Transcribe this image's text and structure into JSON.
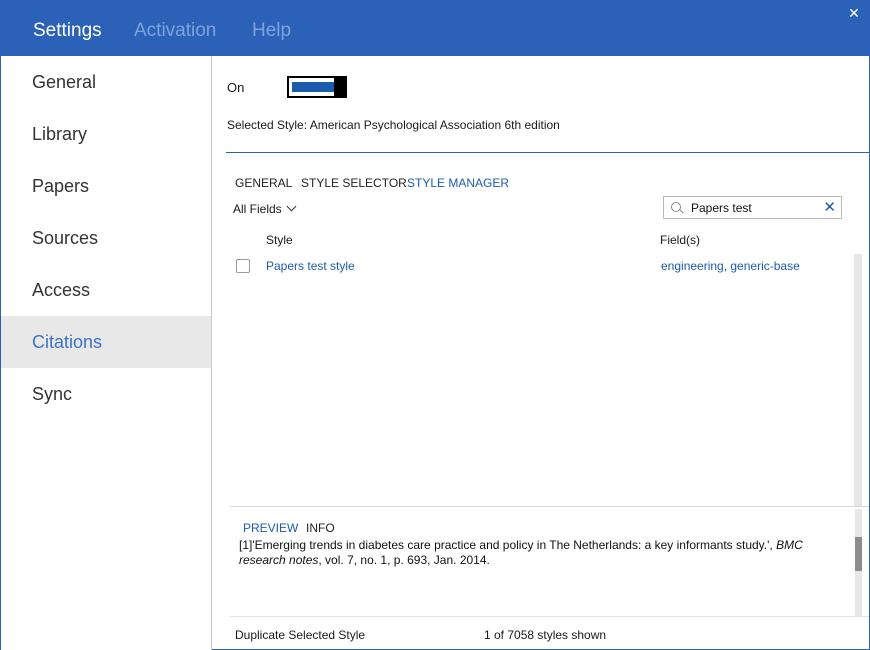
{
  "titlebar": {
    "tabs": [
      {
        "label": "Settings",
        "active": true
      },
      {
        "label": "Activation",
        "active": false
      },
      {
        "label": "Help",
        "active": false
      }
    ],
    "close_label": "✕"
  },
  "sidebar": {
    "items": [
      {
        "label": "General"
      },
      {
        "label": "Library"
      },
      {
        "label": "Papers"
      },
      {
        "label": "Sources"
      },
      {
        "label": "Access"
      },
      {
        "label": "Citations",
        "active": true
      },
      {
        "label": "Sync"
      }
    ]
  },
  "main": {
    "toggle_label": "On",
    "toggle_state": true,
    "selected_style": "Selected Style: American Psychological Association 6th edition",
    "tabs": [
      {
        "label": "GENERAL"
      },
      {
        "label": "STYLE SELECTOR"
      },
      {
        "label": "STYLE MANAGER",
        "active": true
      }
    ],
    "filter": {
      "label": "All Fields"
    },
    "search": {
      "value": "Papers test",
      "clear_label": "✕"
    },
    "table": {
      "headers": {
        "style": "Style",
        "fields": "Field(s)"
      },
      "rows": [
        {
          "style": "Papers test style",
          "fields": "engineering, generic-base",
          "checked": false
        }
      ]
    },
    "preview": {
      "tabs": [
        {
          "label": "PREVIEW",
          "active": true
        },
        {
          "label": "INFO"
        }
      ],
      "text_plain": "[1]'Emerging trends in diabetes care practice and policy in The Netherlands: a key informants study.', ",
      "text_italic": "BMC research notes",
      "text_tail": ", vol. 7, no. 1, p. 693, Jan. 2014."
    },
    "footer": {
      "duplicate_label": "Duplicate Selected Style",
      "count_label": "1 of 7058 styles shown"
    }
  },
  "colors": {
    "accent": "#2b62b8",
    "link": "#1c5cae",
    "inactive_title": "#7ea3da",
    "sidebar_active_bg": "#e8e8e8"
  }
}
